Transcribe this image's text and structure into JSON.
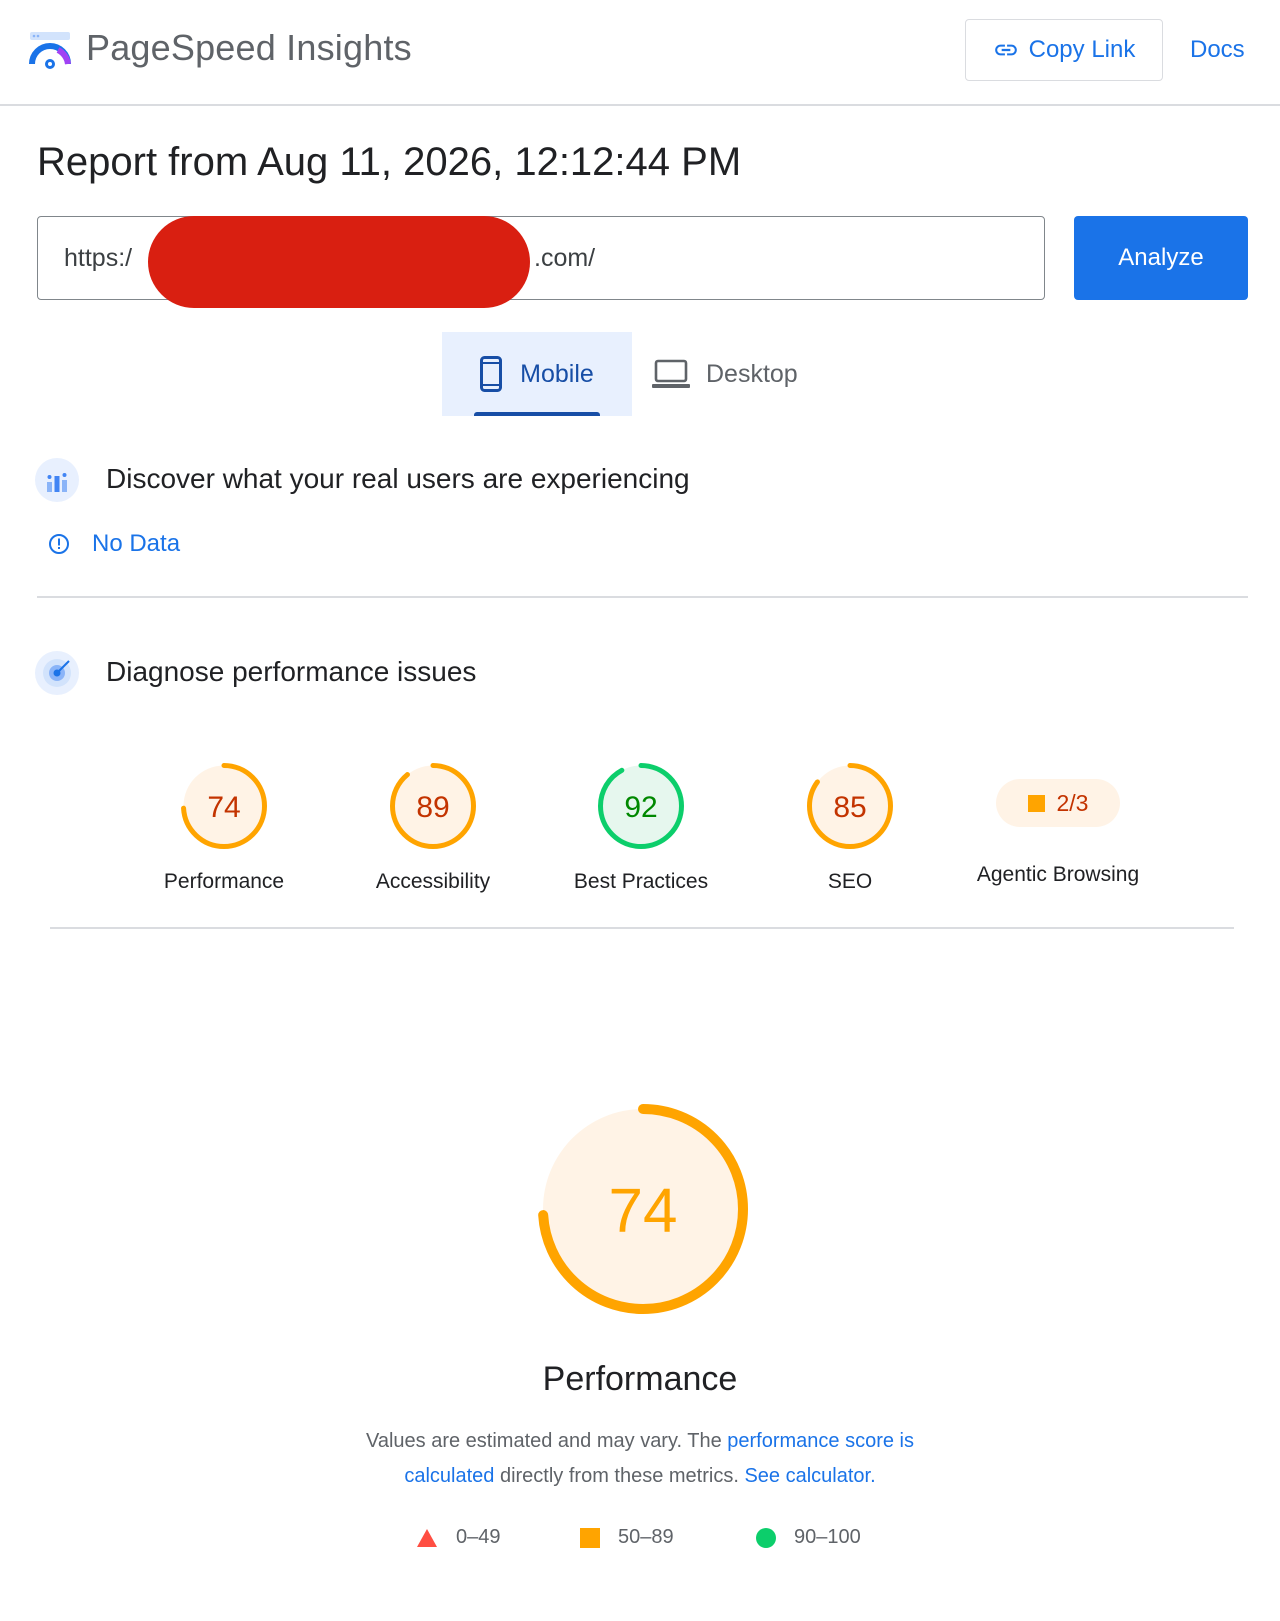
{
  "header": {
    "app_title": "PageSpeed Insights",
    "copy_link_label": "Copy Link",
    "docs_label": "Docs"
  },
  "report": {
    "title": "Report from Aug 11, 2026, 12:12:44 PM"
  },
  "url_form": {
    "prefix": "https:/",
    "suffix": ".com/",
    "analyze_label": "Analyze"
  },
  "device_tabs": [
    {
      "label": "Mobile",
      "selected": true
    },
    {
      "label": "Desktop",
      "selected": false
    }
  ],
  "field_data": {
    "title": "Discover what your real users are experiencing",
    "status": "No Data"
  },
  "lab_data": {
    "title": "Diagnose performance issues"
  },
  "categories": [
    {
      "name": "Performance",
      "score": 74,
      "color": "#ffa400",
      "text_color": "#c33300",
      "fill": "#fff3e6"
    },
    {
      "name": "Accessibility",
      "score": 89,
      "color": "#ffa400",
      "text_color": "#c33300",
      "fill": "#fff3e6"
    },
    {
      "name": "Best Practices",
      "score": 92,
      "color": "#0cce6b",
      "text_color": "#008800",
      "fill": "#e6f7ee"
    },
    {
      "name": "SEO",
      "score": 85,
      "color": "#ffa400",
      "text_color": "#c33300",
      "fill": "#fff3e6"
    },
    {
      "name": "Agentic Browsing",
      "value": "2/3",
      "color": "#ffa400",
      "text_color": "#c33300"
    }
  ],
  "performance": {
    "score": 74,
    "title": "Performance",
    "desc_text1": "Values are estimated and may vary. The ",
    "desc_link1": "performance score is calculated",
    "desc_text2": " directly from these metrics. ",
    "desc_link2": "See calculator."
  },
  "legend": [
    {
      "range": "0–49",
      "shape": "triangle",
      "color": "#ff4e42"
    },
    {
      "range": "50–89",
      "shape": "square",
      "color": "#ffa400"
    },
    {
      "range": "90–100",
      "shape": "circle",
      "color": "#0cce6b"
    }
  ],
  "colors": {
    "accent": "#1a73e8",
    "redaction": "#d91f11"
  }
}
